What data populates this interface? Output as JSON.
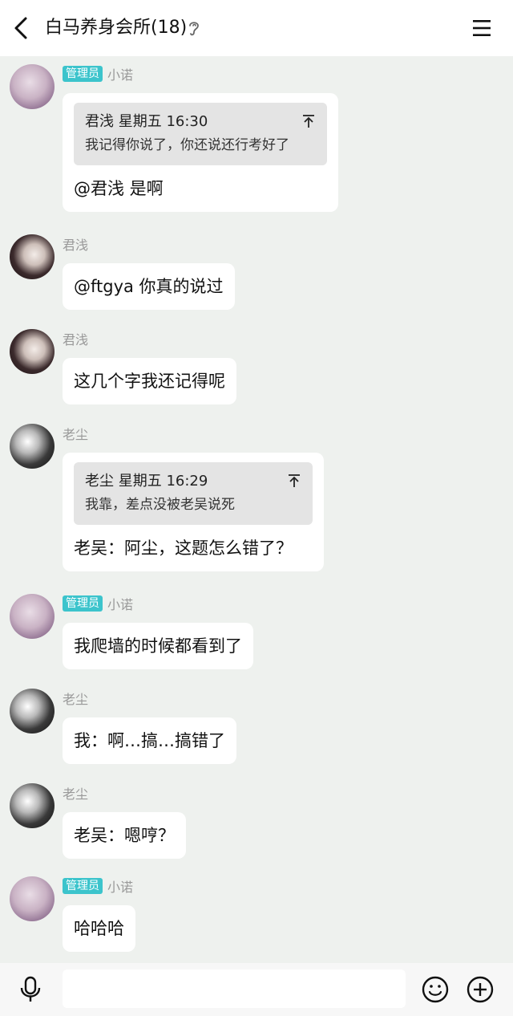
{
  "header": {
    "title": "白马养身会所(18)",
    "icons": [
      "back-icon",
      "ear-icon",
      "menu-icon"
    ]
  },
  "messages": [
    {
      "sender": "小诺",
      "badge": "管理员",
      "quote_head": "君浅 星期五 16:30",
      "quote_text": "我记得你说了，你还说还行考好了",
      "text": "@君浅 是啊"
    },
    {
      "sender": "君浅",
      "text": "@ftgya 你真的说过"
    },
    {
      "sender": "君浅",
      "text": "这几个字我还记得呢"
    },
    {
      "sender": "老尘",
      "quote_head": "老尘 星期五 16:29",
      "quote_text": "我靠，差点没被老吴说死",
      "text": "老吴：阿尘，这题怎么错了？"
    },
    {
      "sender": "小诺",
      "badge": "管理员",
      "text": "我爬墙的时候都看到了"
    },
    {
      "sender": "老尘",
      "text": "我：啊…搞…搞错了"
    },
    {
      "sender": "老尘",
      "text": "老吴：嗯哼？"
    },
    {
      "sender": "小诺",
      "badge": "管理员",
      "text": "哈哈哈"
    }
  ],
  "input": {
    "placeholder": ""
  },
  "colors": {
    "background": "#eef1ee",
    "badge": "#3cc4cc",
    "bubble": "#ffffff",
    "quote": "#e4e4e4"
  }
}
